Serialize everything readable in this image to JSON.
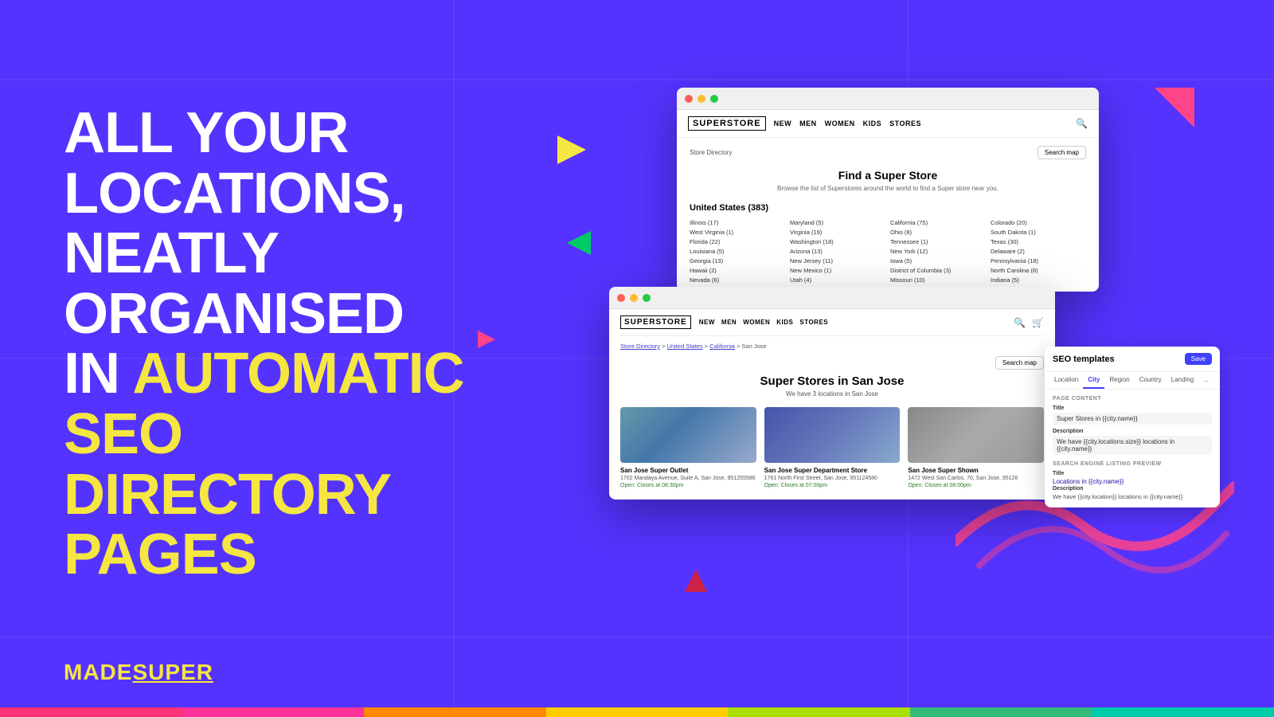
{
  "page": {
    "background_color": "#5533ff",
    "title": "All Your Locations, Neatly Organised in Automatic SEO Directory Pages"
  },
  "hero": {
    "line1": "ALL YOUR LOCATIONS,",
    "line2": "NEATLY ORGANISED",
    "line3_prefix": "IN ",
    "line3_highlight": "AUTOMATIC SEO",
    "line4": "DIRECTORY PAGES"
  },
  "logo": {
    "prefix": "MADE",
    "highlight": "SUPER"
  },
  "decorative_shapes": {
    "triangle_yellow": "▶",
    "triangle_green": "▶",
    "triangle_pink_right": "▶",
    "triangle_red": "▶",
    "corner_pink": ""
  },
  "window_main": {
    "brand": "SUPERSTORE",
    "nav_items": [
      "NEW",
      "MEN",
      "WOMEN",
      "KIDS",
      "STORES"
    ],
    "breadcrumb": "Store Directory",
    "search_map_btn": "Search map",
    "find_title": "Find a Super Store",
    "find_sub": "Browse the list of Superstores around the world to find a Super store near you.",
    "country_section": "United States (383)",
    "states": [
      "Illinois (17)",
      "Maryland (5)",
      "California (75)",
      "Colorado (20)",
      "West Virginia (1)",
      "Virginia (19)",
      "Ohio (8)",
      "South Dakota (1)",
      "Florida (22)",
      "Washington (18)",
      "Tennessee (1)",
      "Texas (30)",
      "Louisiana (5)",
      "Arizona (13)",
      "New York (12)",
      "Delaware (2)",
      "Georgia (13)",
      "New Jersey (11)",
      "Iowa (5)",
      "Pennsylvania (18)",
      "Hawaii (2)",
      "New Mexico (1)",
      "District of Columbia (3)",
      "North Carolina (8)",
      "Nevada (6)",
      "Utah (4)",
      "Missouri (10)",
      "Indiana (5)"
    ]
  },
  "window_sanjose": {
    "brand": "SUPERSTORE",
    "nav_items": [
      "NEW",
      "MEN",
      "WOMEN",
      "KIDS",
      "STORES"
    ],
    "breadcrumb_parts": [
      "Store Directory",
      "United States",
      "California",
      "San Jose"
    ],
    "search_map_btn": "Search map",
    "page_title": "Super Stores in San Jose",
    "page_sub": "We have 3 locations in San Jose",
    "stores": [
      {
        "name": "San Jose Super Outlet",
        "address": "1702 Maralaya Avenue, Suite A, San Jose, 951255586",
        "hours": "Open: Closes at 08:30pm",
        "img_class": "img-outlet"
      },
      {
        "name": "San Jose Super Department Store",
        "address": "1761 North First Street, San Jose, 951124580",
        "hours": "Open: Closes at 07:00pm",
        "img_class": "img-dept"
      },
      {
        "name": "San Jose Super Shown",
        "address": "1472 West San Carlos, 70, San Jose, 95126",
        "hours": "Open: Closes at 08:00pm",
        "img_class": "img-shown"
      }
    ]
  },
  "seo_panel": {
    "title": "SEO templates",
    "save_btn": "Save",
    "tabs": [
      "Location",
      "City",
      "Region",
      "Country",
      "Landing",
      "..."
    ],
    "active_tab": "City",
    "page_content_label": "PAGE CONTENT",
    "title_label": "Title",
    "title_value": "Super Stores in {{city.name}}",
    "description_label": "Description",
    "description_value": "We have {{city.locations.size}} locations in {{city.name}}",
    "preview_label": "SEARCH ENGINE LISTING PREVIEW",
    "preview_title_label": "Title",
    "preview_title_value": "Locations in {{city.name}}",
    "preview_desc_label": "Description",
    "preview_desc_value": "We have {{city.location}} locations in {{city.name}}"
  },
  "bottom_bars": {
    "colors": [
      "#ff4477",
      "#ff44aa",
      "#ff9900",
      "#ffcc00",
      "#ccee00",
      "#44cc88",
      "#00ccbb"
    ]
  }
}
